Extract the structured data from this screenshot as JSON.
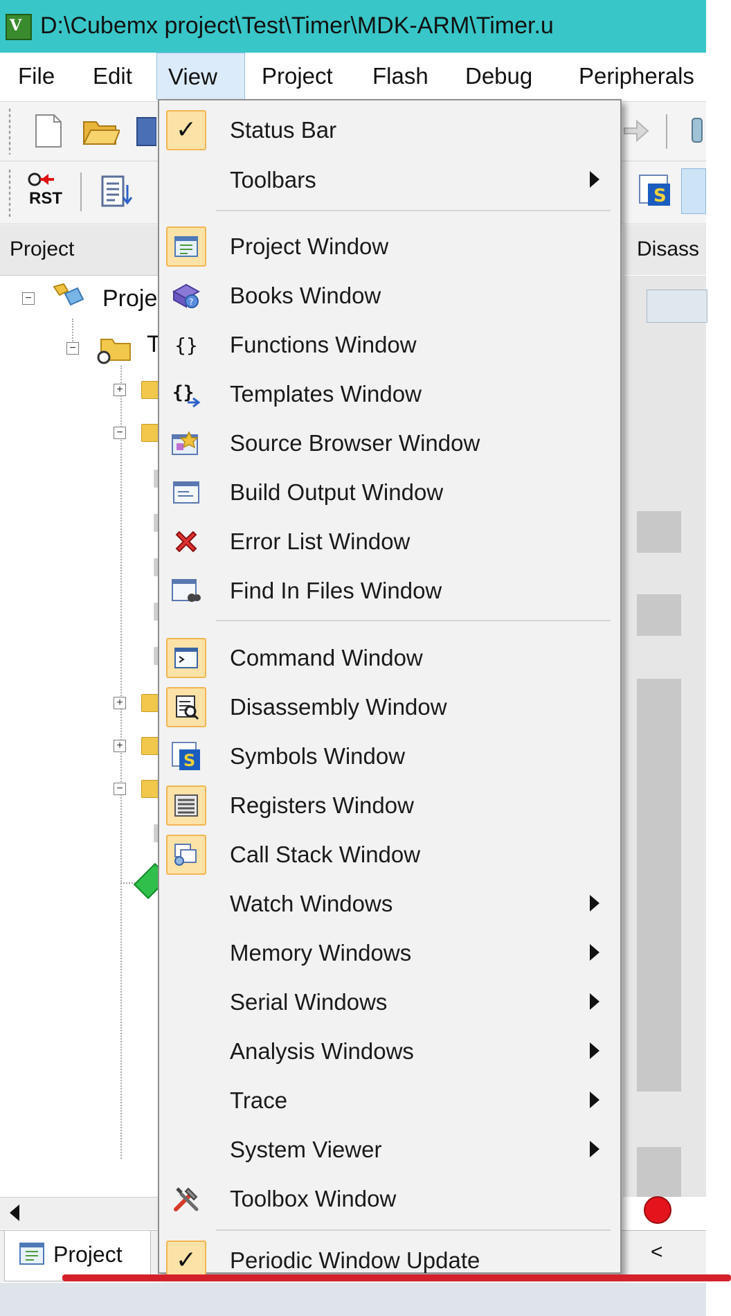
{
  "window": {
    "title": "D:\\Cubemx project\\Test\\Timer\\MDK-ARM\\Timer.u"
  },
  "menubar": {
    "items": [
      "File",
      "Edit",
      "View",
      "Project",
      "Flash",
      "Debug",
      "Peripherals"
    ],
    "active": "View"
  },
  "toolbar": {
    "rst_label": "RST"
  },
  "panels": {
    "project_header": "Project",
    "disassembly_header": "Disass",
    "tree_root_label": "Proje",
    "tree_target_label": "T",
    "bottom_tab": "Project"
  },
  "view_menu": {
    "items": [
      {
        "label": "Status Bar",
        "icon": "checkmark-icon",
        "checked": true,
        "submenu": false
      },
      {
        "label": "Toolbars",
        "icon": "",
        "checked": false,
        "submenu": true
      },
      {
        "label": "Project Window",
        "icon": "project-window-icon",
        "checked": true,
        "submenu": false
      },
      {
        "label": "Books Window",
        "icon": "books-icon",
        "checked": false,
        "submenu": false
      },
      {
        "label": "Functions Window",
        "icon": "braces-icon",
        "checked": false,
        "submenu": false
      },
      {
        "label": "Templates Window",
        "icon": "templates-icon",
        "checked": false,
        "submenu": false
      },
      {
        "label": "Source Browser Window",
        "icon": "source-browser-icon",
        "checked": false,
        "submenu": false
      },
      {
        "label": "Build Output Window",
        "icon": "build-output-icon",
        "checked": false,
        "submenu": false
      },
      {
        "label": "Error List Window",
        "icon": "error-x-icon",
        "checked": false,
        "submenu": false
      },
      {
        "label": "Find In Files Window",
        "icon": "find-in-files-icon",
        "checked": false,
        "submenu": false
      },
      {
        "label": "Command Window",
        "icon": "command-prompt-icon",
        "checked": true,
        "submenu": false
      },
      {
        "label": "Disassembly Window",
        "icon": "disassembly-icon",
        "checked": true,
        "submenu": false
      },
      {
        "label": "Symbols Window",
        "icon": "symbols-icon",
        "checked": false,
        "submenu": false
      },
      {
        "label": "Registers Window",
        "icon": "registers-icon",
        "checked": true,
        "submenu": false
      },
      {
        "label": "Call Stack Window",
        "icon": "call-stack-icon",
        "checked": true,
        "submenu": false
      },
      {
        "label": "Watch Windows",
        "icon": "",
        "checked": false,
        "submenu": true
      },
      {
        "label": "Memory Windows",
        "icon": "",
        "checked": false,
        "submenu": true
      },
      {
        "label": "Serial Windows",
        "icon": "",
        "checked": false,
        "submenu": true
      },
      {
        "label": "Analysis Windows",
        "icon": "",
        "checked": false,
        "submenu": true
      },
      {
        "label": "Trace",
        "icon": "",
        "checked": false,
        "submenu": true
      },
      {
        "label": "System Viewer",
        "icon": "",
        "checked": false,
        "submenu": true
      },
      {
        "label": "Toolbox Window",
        "icon": "toolbox-icon",
        "checked": false,
        "submenu": false
      },
      {
        "label": "Periodic Window Update",
        "icon": "checkmark-icon",
        "checked": true,
        "submenu": false
      }
    ]
  },
  "colors": {
    "titlebar": "#39c6c8",
    "menu_active": "#dcebf9",
    "check_highlight": "#fde2a8",
    "annotation_red": "#d4202a"
  }
}
